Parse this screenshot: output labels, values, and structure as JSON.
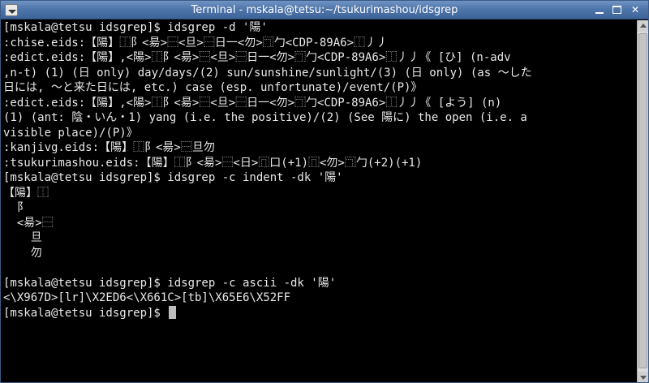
{
  "window": {
    "title": "Terminal - mskala@tetsu:~/tsukurimashou/idsgrep",
    "minimize_label": "",
    "maximize_label": "",
    "close_label": "✕"
  },
  "terminal": {
    "lines": [
      "[mskala@tetsu idsgrep]$ idsgrep -d '陽'",
      ":chise.eids:【陽】⿰阝<昜>⿱<旦>⿱日一<勿>⿹勹<CDP-89A6>⿰丿丿",
      ":edict.eids:【陽】,<陽>⿰阝<昜>⿱<旦>⿱日一<勿>⿹勹<CDP-89A6>⿰丿丿《 [ひ] (n-adv",
      ",n-t) (1) (日 only) day/days/(2) sun/sunshine/sunlight/(3) (日 only) (as ～した",
      "日には, ～と来た日には, etc.) case (esp. unfortunate)/event/(P)》",
      ":edict.eids:【陽】,<陽>⿰阝<昜>⿱<旦>⿱日一<勿>⿹勹<CDP-89A6>⿰丿丿《 [よう] (n)",
      "(1) (ant: 陰・いん・1) yang (i.e. the positive)/(2) (See 陽に) the open (i.e. a",
      "visible place)/(P)》",
      ":kanjivg.eids:【陽】⿰阝<昜>⿱旦勿",
      ":tsukurimashou.eids:【陽】⿰阝<昜>⿱<日>⿵口(+1)⿵<勿>⿹勹(+2)(+1)",
      "[mskala@tetsu idsgrep]$ idsgrep -c indent -dk '陽'",
      "【陽】⿰",
      "  阝",
      "  <昜>⿱",
      "    旦",
      "    勿",
      "",
      "[mskala@tetsu idsgrep]$ idsgrep -c ascii -dk '陽'",
      "<\\X967D>[lr]\\X2ED6<\\X661C>[tb]\\X65E6\\X52FF",
      "[mskala@tetsu idsgrep]$ "
    ]
  }
}
